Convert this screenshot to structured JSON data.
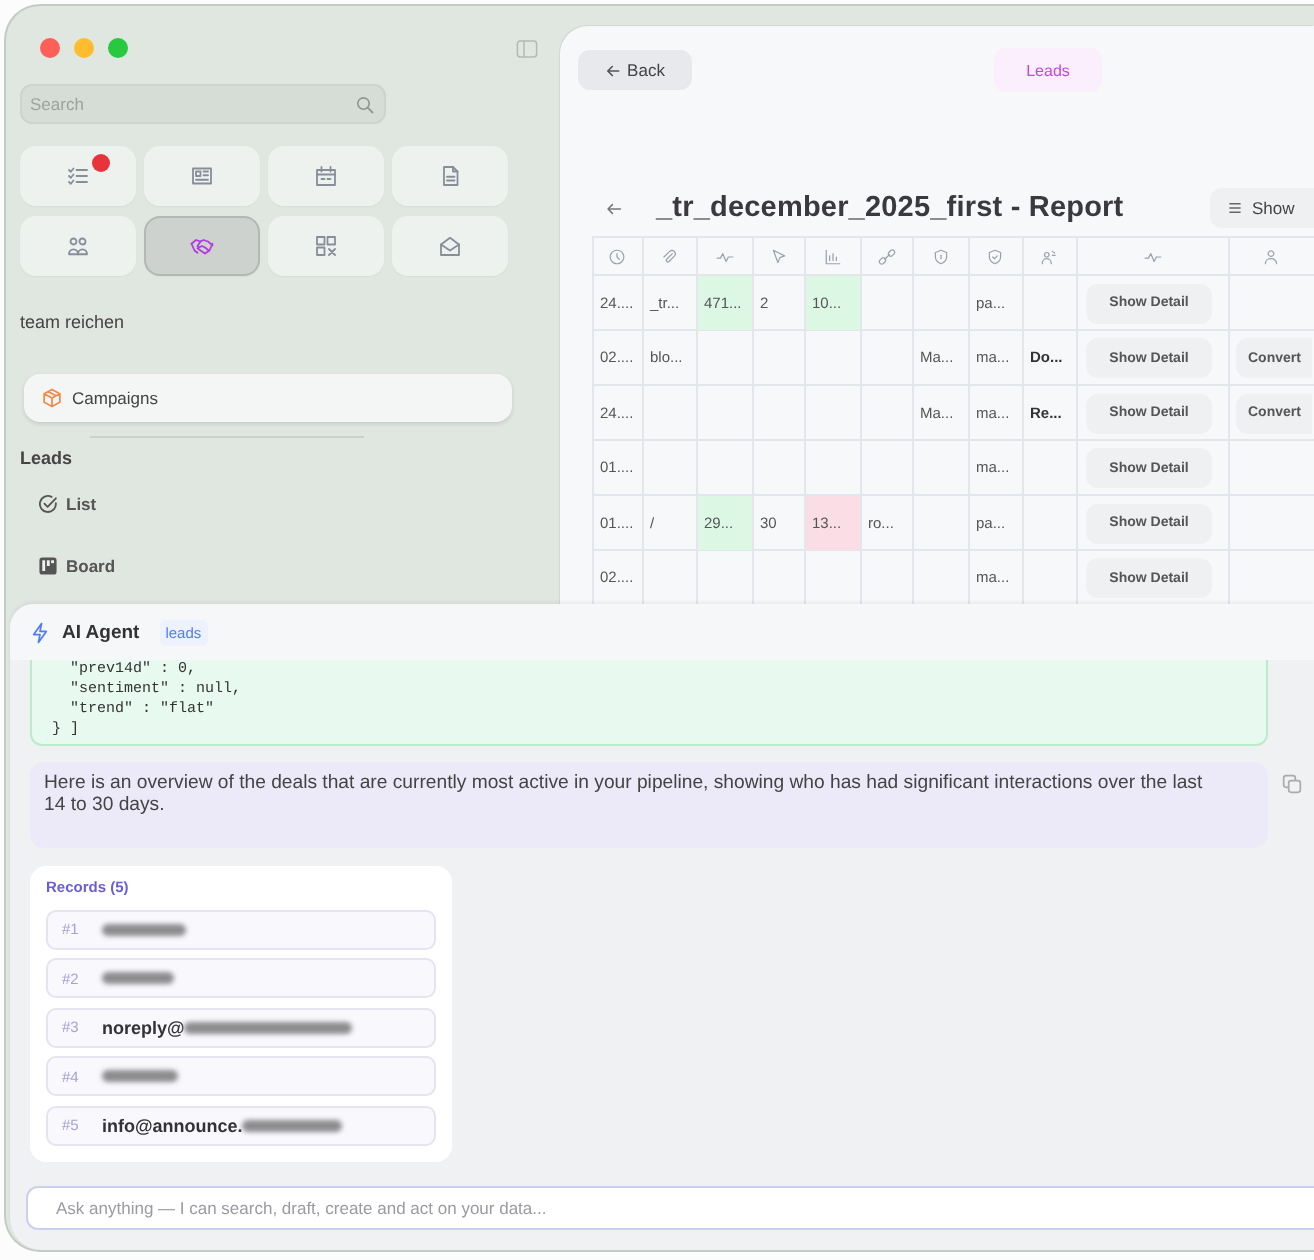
{
  "sidebar": {
    "search": {
      "placeholder": "Search"
    },
    "tiles": [
      {
        "selected": false,
        "badge": true
      },
      {
        "selected": false,
        "badge": false
      },
      {
        "selected": false,
        "badge": false
      },
      {
        "selected": false,
        "badge": false
      },
      {
        "selected": false,
        "badge": false
      },
      {
        "selected": true,
        "badge": false
      },
      {
        "selected": false,
        "badge": false
      },
      {
        "selected": false,
        "badge": false
      }
    ],
    "workspace": "team reichen",
    "pinned": {
      "label": "Campaigns"
    },
    "sections": [
      {
        "title": "Leads",
        "items": [
          {
            "label": "List"
          },
          {
            "label": "Board"
          }
        ]
      }
    ]
  },
  "main": {
    "back_button": "Back",
    "module": "Leads",
    "title": "_tr_december_2025_first - Report",
    "show_button": "Show",
    "table": {
      "rows": [
        {
          "cells": [
            {
              "text": "24....",
              "bold": false
            },
            {
              "text": "_tr...",
              "bold": false
            },
            {
              "text": "471...",
              "bold": false,
              "color": "#dcf8e5"
            },
            {
              "text": "2",
              "bold": false
            },
            {
              "text": "10...",
              "bold": false,
              "color": "#dcf8e5"
            },
            null,
            null,
            {
              "text": "pa...",
              "bold": false
            },
            null
          ],
          "detail": "Show Detail"
        },
        {
          "cells": [
            {
              "text": "02....",
              "bold": false
            },
            {
              "text": "blo...",
              "bold": false
            },
            null,
            null,
            null,
            null,
            {
              "text": "Ma...",
              "bold": false
            },
            {
              "text": "ma...",
              "bold": false
            },
            {
              "text": "Do...",
              "bold": true
            }
          ],
          "detail": "Show Detail",
          "convert": "Convert"
        },
        {
          "cells": [
            {
              "text": "24....",
              "bold": false
            },
            null,
            null,
            null,
            null,
            null,
            {
              "text": "Ma...",
              "bold": false
            },
            {
              "text": "ma...",
              "bold": false
            },
            {
              "text": "Re...",
              "bold": true
            }
          ],
          "detail": "Show Detail",
          "convert": "Convert"
        },
        {
          "cells": [
            {
              "text": "01....",
              "bold": false
            },
            null,
            null,
            null,
            null,
            null,
            null,
            {
              "text": "ma...",
              "bold": false
            },
            null
          ],
          "detail": "Show Detail"
        },
        {
          "cells": [
            {
              "text": "01....",
              "bold": false
            },
            {
              "text": "/",
              "bold": false
            },
            {
              "text": "29...",
              "bold": false,
              "color": "#dcf8e5"
            },
            {
              "text": "30",
              "bold": false
            },
            {
              "text": "13...",
              "bold": false,
              "color": "#fadde5"
            },
            {
              "text": "ro...",
              "bold": false
            },
            null,
            {
              "text": "pa...",
              "bold": false
            },
            null
          ],
          "detail": "Show Detail"
        },
        {
          "cells": [
            {
              "text": "02....",
              "bold": false
            },
            null,
            null,
            null,
            null,
            null,
            null,
            {
              "text": "ma...",
              "bold": false
            },
            null
          ],
          "detail": "Show Detail"
        }
      ]
    }
  },
  "agent": {
    "title": "AI Agent",
    "context": "leads",
    "code_lines": [
      "  \"prev14d\" : 0,",
      "  \"sentiment\" : null,",
      "  \"trend\" : \"flat\"",
      "} ]"
    ],
    "message": "Here is an overview of the deals that are currently most active in your pipeline, showing who has had significant interactions over the last 14 to 30 days.",
    "records": {
      "title": "Records (5)",
      "items": [
        {
          "number": "#1",
          "redacted": true
        },
        {
          "number": "#2",
          "redacted": true
        },
        {
          "number": "#3",
          "text": "noreply@",
          "redacted": true
        },
        {
          "number": "#4",
          "redacted": true
        },
        {
          "number": "#5",
          "text": "info@announce.",
          "redacted": true
        }
      ]
    },
    "input": {
      "placeholder": "Ask anything — I can search, draft, create and act on your data..."
    }
  }
}
